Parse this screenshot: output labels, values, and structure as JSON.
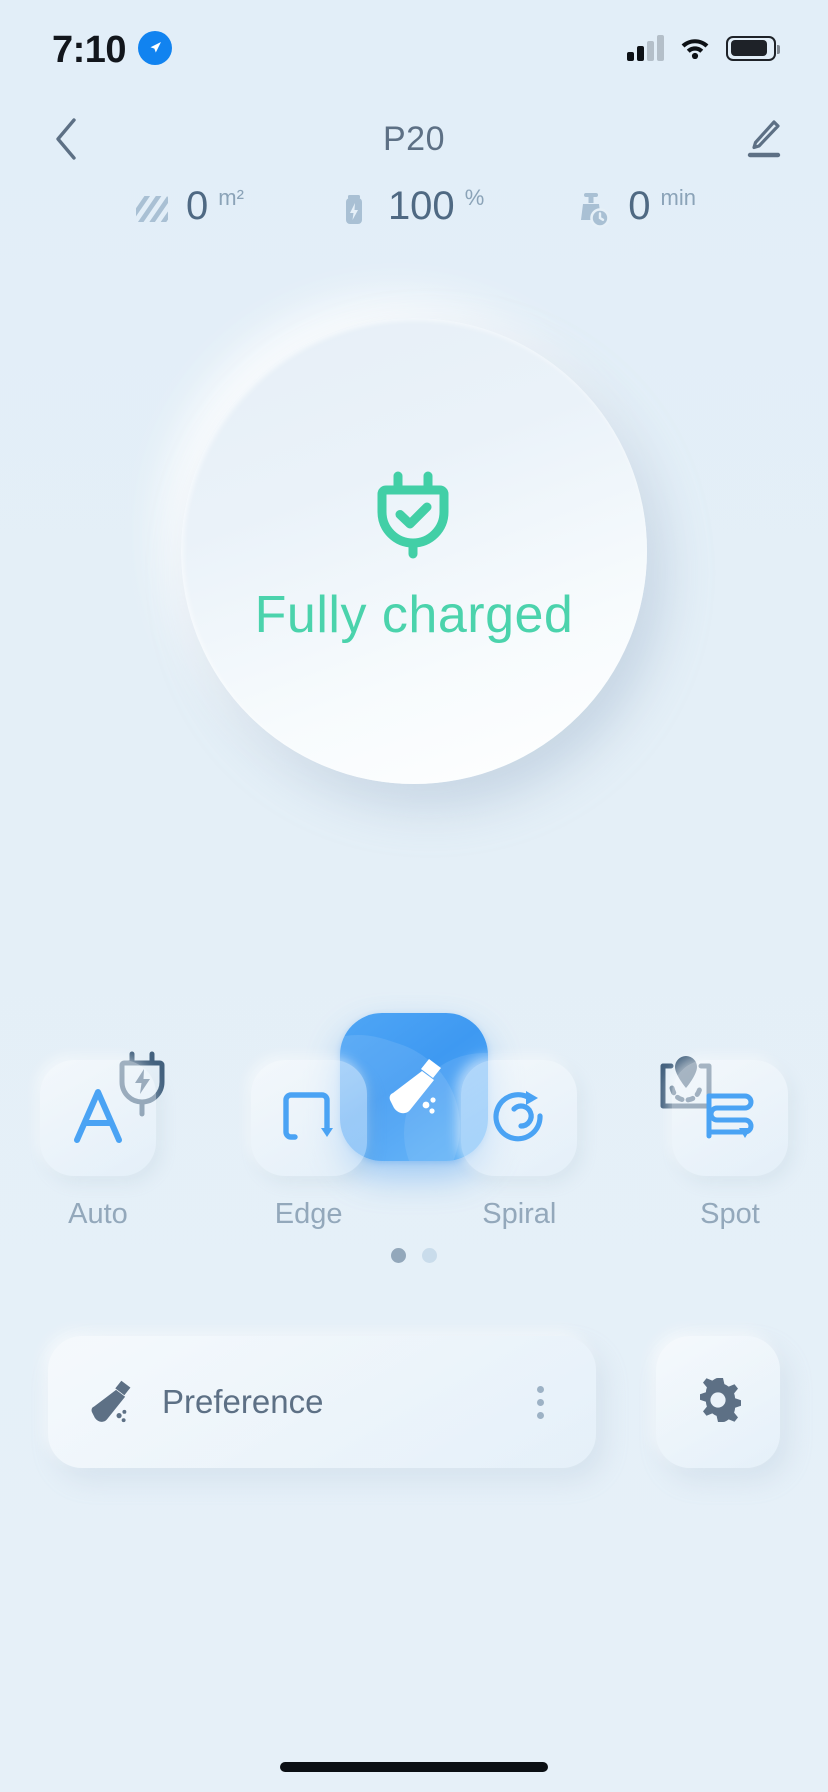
{
  "status_bar": {
    "time": "7:10",
    "location_icon": "location-arrow-icon",
    "signal_icon": "cellular-signal-icon",
    "wifi_icon": "wifi-icon",
    "battery_icon": "battery-icon"
  },
  "nav": {
    "back_icon": "chevron-left-icon",
    "title": "P20",
    "edit_icon": "pencil-edit-icon"
  },
  "stats": [
    {
      "icon": "area-hatch-icon",
      "value": "0",
      "unit": "m²",
      "name": "cleaned-area"
    },
    {
      "icon": "battery-level-icon",
      "value": "100",
      "unit": "%",
      "name": "battery-level"
    },
    {
      "icon": "clean-time-icon",
      "value": "0",
      "unit": "min",
      "name": "cleaning-time"
    }
  ],
  "device_status": {
    "icon": "plug-check-icon",
    "text": "Fully charged",
    "accent_color": "#4bd3ac"
  },
  "actions": {
    "dock": {
      "icon": "plug-charge-icon",
      "name": "return-to-dock-button"
    },
    "start": {
      "icon": "broom-clean-icon",
      "name": "start-clean-button",
      "color": "#4aa3f4"
    },
    "locate": {
      "icon": "map-pin-icon",
      "name": "locate-robot-button"
    }
  },
  "modes": [
    {
      "icon": "letter-a-icon",
      "label": "Auto"
    },
    {
      "icon": "edge-rectangle-icon",
      "label": "Edge"
    },
    {
      "icon": "spiral-icon",
      "label": "Spiral"
    },
    {
      "icon": "spot-zigzag-icon",
      "label": "Spot"
    }
  ],
  "pagination": {
    "total": 2,
    "active": 1
  },
  "bottom": {
    "preference": {
      "icon": "broom-icon",
      "label": "Preference",
      "more_icon": "more-vertical-icon"
    },
    "settings": {
      "icon": "gear-icon"
    }
  }
}
